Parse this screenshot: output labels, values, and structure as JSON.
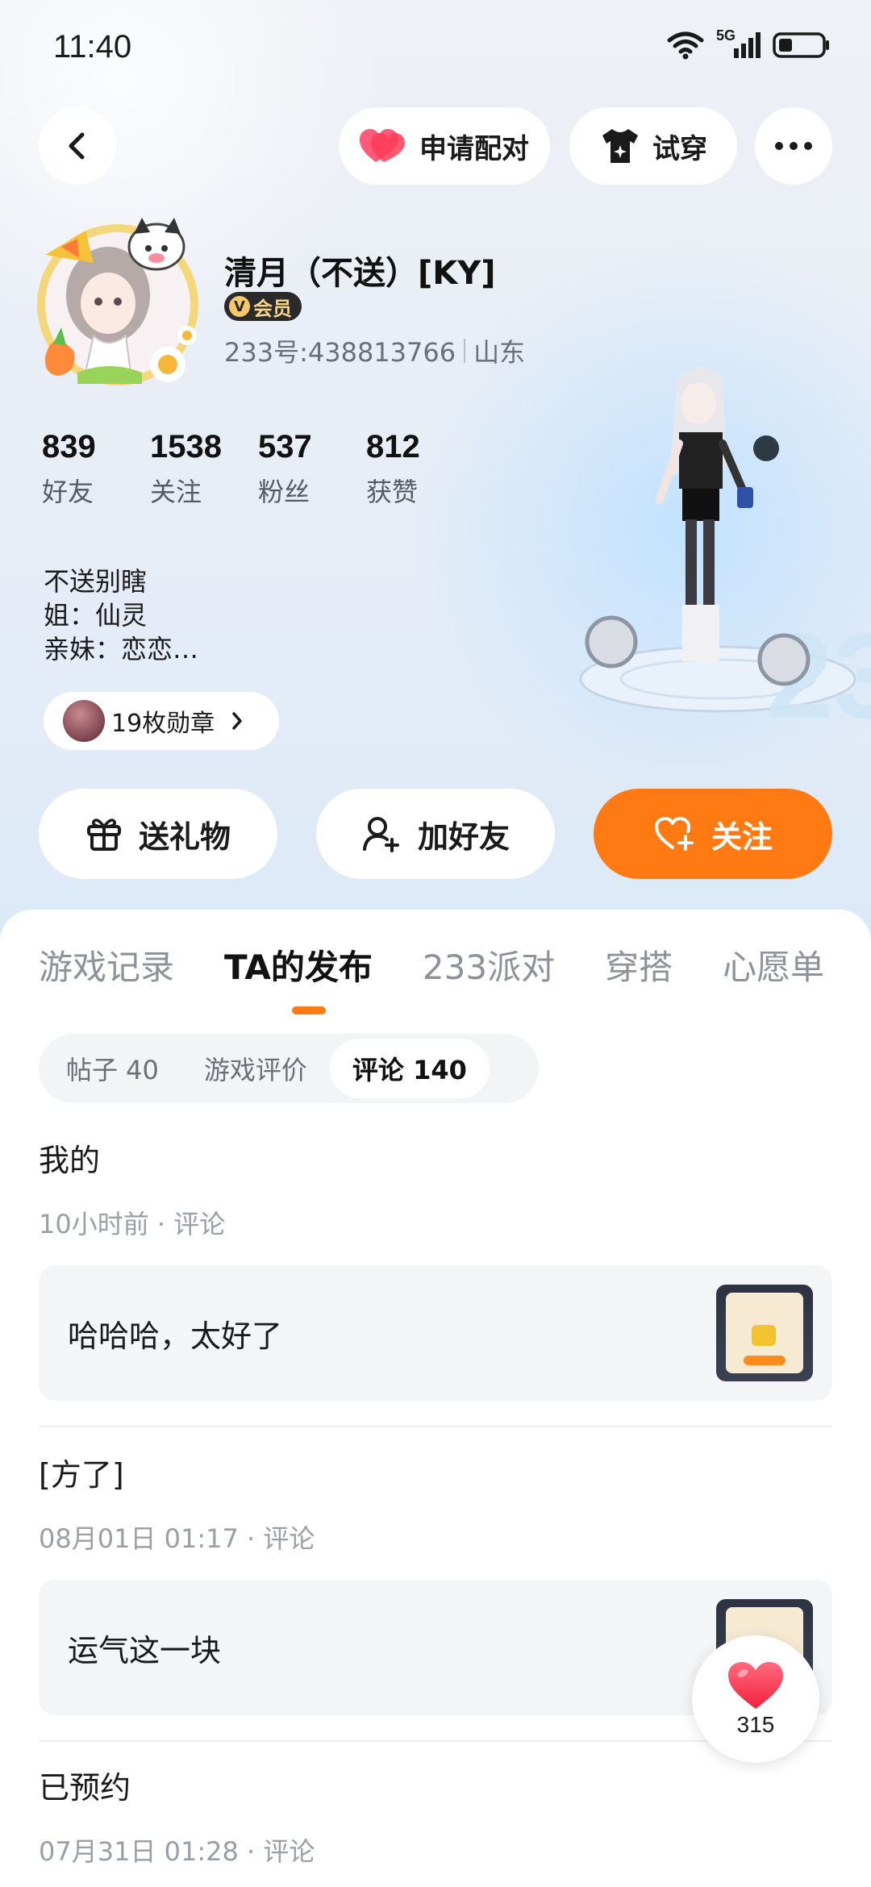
{
  "status_bar": {
    "time": "11:40",
    "network": "5G"
  },
  "top_bar": {
    "pair_label": "申请配对",
    "try_on_label": "试穿"
  },
  "profile": {
    "nickname": "清月（不送）[KY]",
    "vip_label": "会员",
    "user_id": "233号:438813766",
    "location": "山东",
    "stats": [
      {
        "value": "839",
        "label": "好友"
      },
      {
        "value": "1538",
        "label": "关注"
      },
      {
        "value": "537",
        "label": "粉丝"
      },
      {
        "value": "812",
        "label": "获赞"
      }
    ],
    "bio_lines": [
      "不送别瞎",
      "姐：仙灵",
      "亲妹：恋恋…"
    ],
    "badges_label": "19枚勋章"
  },
  "actions": {
    "gift": "送礼物",
    "add_friend": "加好友",
    "follow": "关注"
  },
  "tabs": [
    {
      "label": "游戏记录",
      "active": false
    },
    {
      "label": "TA的发布",
      "active": true
    },
    {
      "label": "233派对",
      "active": false
    },
    {
      "label": "穿搭",
      "active": false
    },
    {
      "label": "心愿单",
      "active": false
    }
  ],
  "subtabs": [
    {
      "label": "帖子 40",
      "active": false
    },
    {
      "label": "游戏评价",
      "active": false
    },
    {
      "label": "评论 140",
      "active": true
    }
  ],
  "posts": [
    {
      "title": "我的",
      "meta": "10小时前 · 评论",
      "quote": "哈哈哈，太好了"
    },
    {
      "title": "[方了]",
      "meta": "08月01日 01:17 · 评论",
      "quote": "运气这一块"
    },
    {
      "title": "已预约",
      "meta": "07月31日 01:28 · 评论"
    }
  ],
  "like_fab": {
    "count": "315"
  },
  "colors": {
    "accent": "#ff7a12",
    "heart": "#ff3b57"
  }
}
